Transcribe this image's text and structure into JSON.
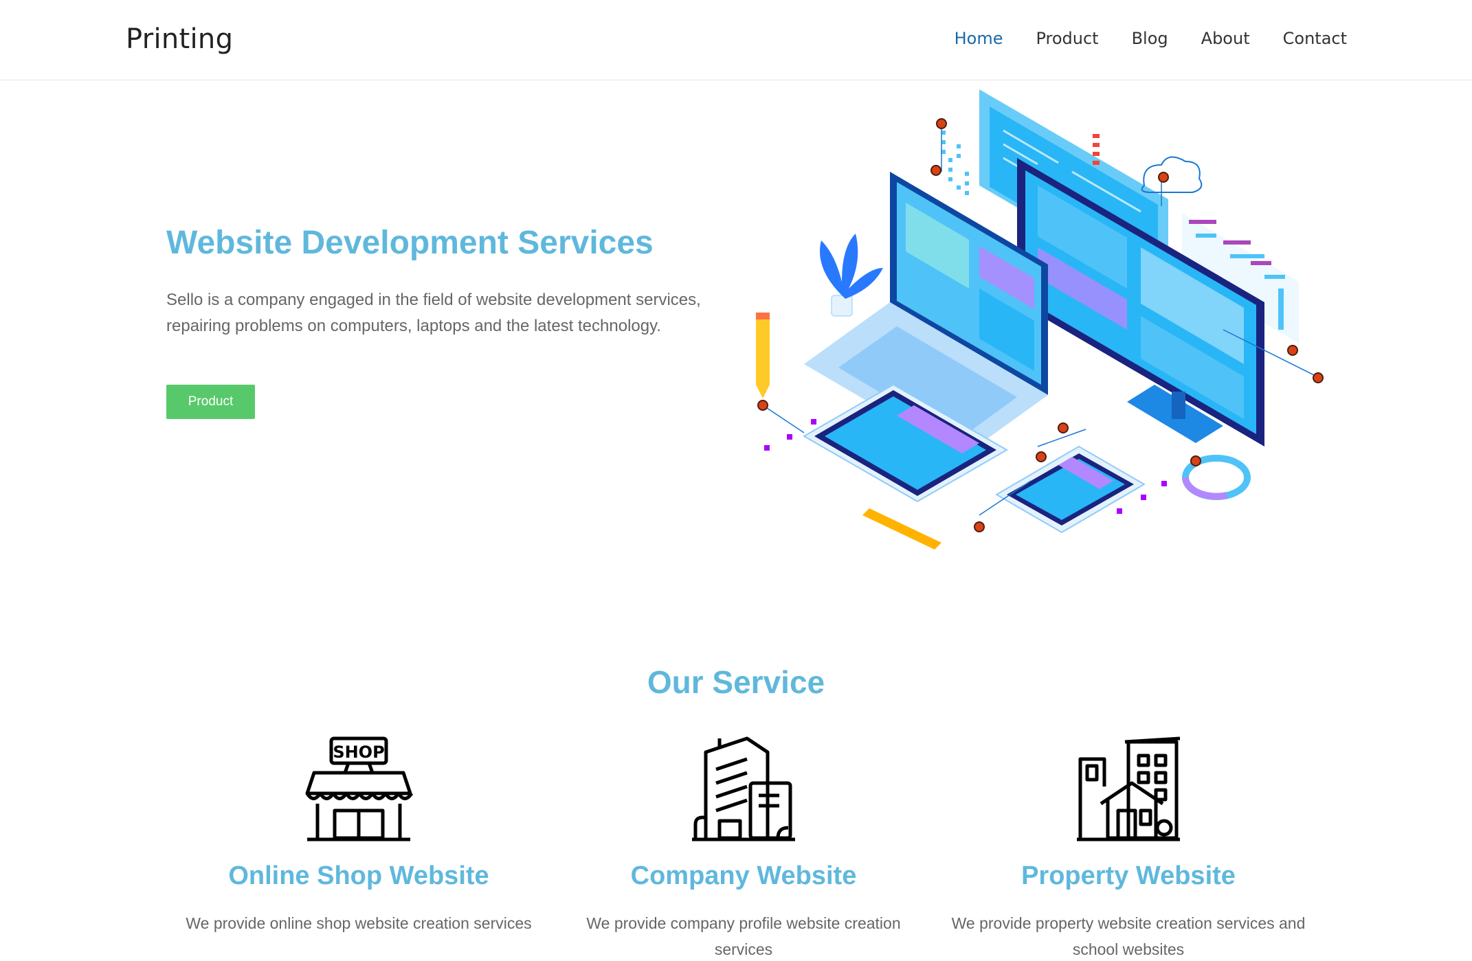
{
  "brand": "Printing",
  "nav": {
    "items": [
      {
        "label": "Home",
        "active": true
      },
      {
        "label": "Product",
        "active": false
      },
      {
        "label": "Blog",
        "active": false
      },
      {
        "label": "About",
        "active": false
      },
      {
        "label": "Contact",
        "active": false
      }
    ]
  },
  "hero": {
    "title": "Website Development Services",
    "text": "Sello is a company engaged in the field of website development services, repairing problems on computers, laptops and the latest technology.",
    "button_label": "Product",
    "illustration": "isometric-devices-illustration"
  },
  "services": {
    "title": "Our Service",
    "items": [
      {
        "icon": "shop-icon",
        "shop_sign": "SHOP",
        "title": "Online Shop Website",
        "text": "We provide online shop website creation services"
      },
      {
        "icon": "company-building-icon",
        "title": "Company Website",
        "text": "We provide company profile website creation services"
      },
      {
        "icon": "property-buildings-icon",
        "title": "Property Website",
        "text": "We provide property website creation services and school websites"
      }
    ]
  },
  "colors": {
    "accent": "#5fb8dc",
    "nav_active": "#1769aa",
    "button": "#58c96a",
    "body_text": "#666666"
  }
}
